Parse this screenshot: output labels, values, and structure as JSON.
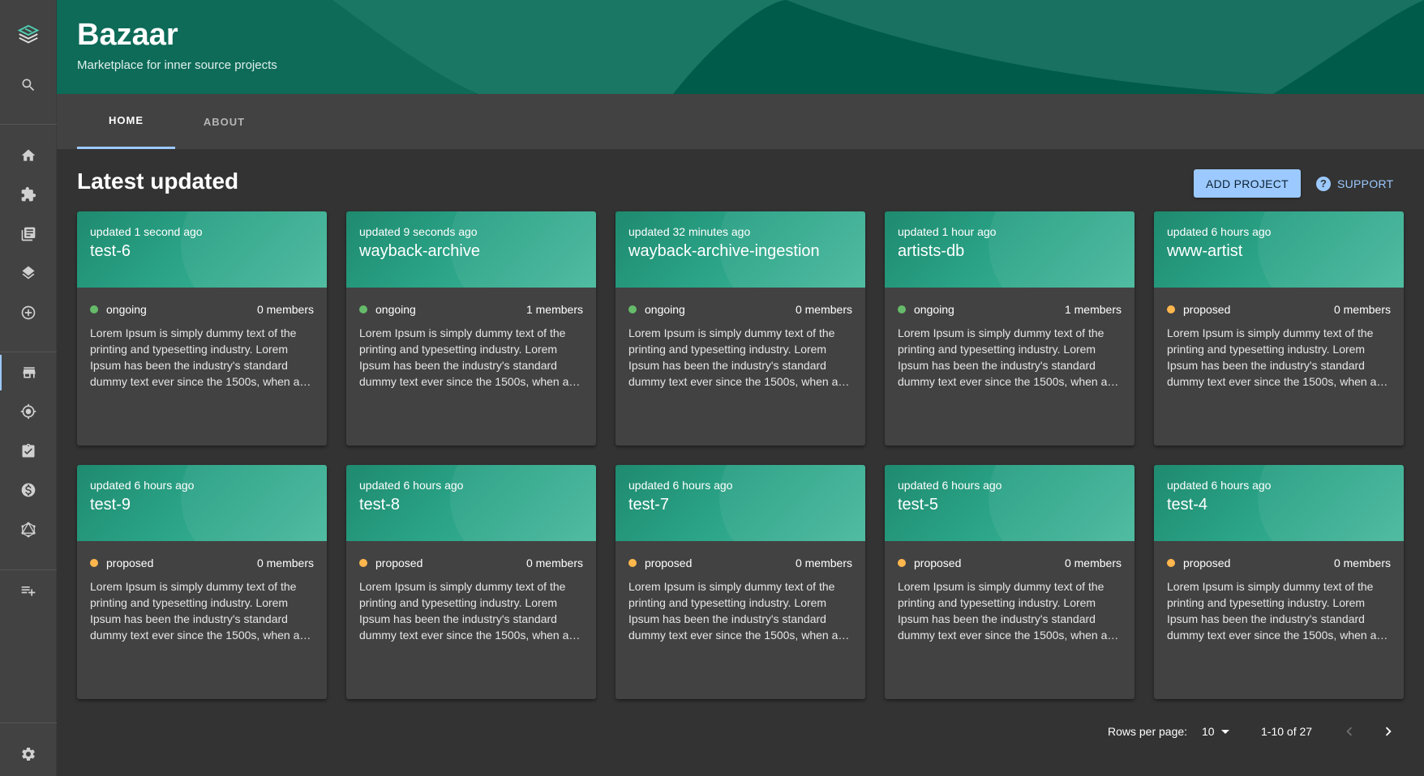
{
  "app": {
    "title": "Bazaar",
    "subtitle": "Marketplace for inner source projects"
  },
  "sidebar": {
    "items": [
      {
        "icon": "app-logo-icon"
      },
      {
        "icon": "search-icon"
      },
      {
        "icon": "home-icon"
      },
      {
        "icon": "extension-icon"
      },
      {
        "icon": "library-books-icon"
      },
      {
        "icon": "layers-icon"
      },
      {
        "icon": "add-circle-icon"
      },
      {
        "icon": "storefront-icon",
        "active": true
      },
      {
        "icon": "gps-target-icon"
      },
      {
        "icon": "assignment-check-icon"
      },
      {
        "icon": "money-icon"
      },
      {
        "icon": "graphql-icon"
      },
      {
        "icon": "playlist-add-icon"
      },
      {
        "icon": "gear-icon"
      }
    ]
  },
  "tabs": [
    {
      "label": "HOME",
      "active": true
    },
    {
      "label": "ABOUT",
      "active": false
    }
  ],
  "main": {
    "section_title": "Latest updated",
    "add_project_label": "ADD PROJECT",
    "support_label": "SUPPORT"
  },
  "status_colors": {
    "ongoing": "#66bb6a",
    "proposed": "#ffb74d"
  },
  "projects": [
    {
      "updated": "updated 1 second ago",
      "name": "test-6",
      "status": "ongoing",
      "members": "0 members",
      "description": "Lorem Ipsum is simply dummy text of the printing and typesetting industry. Lorem Ipsum has been the industry's standard dummy text ever since the 1500s, when an unknown printer took a galley of type and…"
    },
    {
      "updated": "updated 9 seconds ago",
      "name": "wayback-archive",
      "status": "ongoing",
      "members": "1 members",
      "description": "Lorem Ipsum is simply dummy text of the printing and typesetting industry. Lorem Ipsum has been the industry's standard dummy text ever since the 1500s, when an unknown printer took a galley of type and…"
    },
    {
      "updated": "updated 32 minutes ago",
      "name": "wayback-archive-ingestion",
      "status": "ongoing",
      "members": "0 members",
      "description": "Lorem Ipsum is simply dummy text of the printing and typesetting industry. Lorem Ipsum has been the industry's standard dummy text ever since the 1500s, when an unknown printer took a galley of type and…"
    },
    {
      "updated": "updated 1 hour ago",
      "name": "artists-db",
      "status": "ongoing",
      "members": "1 members",
      "description": "Lorem Ipsum is simply dummy text of the printing and typesetting industry. Lorem Ipsum has been the industry's standard dummy text ever since the 1500s, when an unknown printer took a galley of type and…"
    },
    {
      "updated": "updated 6 hours ago",
      "name": "www-artist",
      "status": "proposed",
      "members": "0 members",
      "description": "Lorem Ipsum is simply dummy text of the printing and typesetting industry. Lorem Ipsum has been the industry's standard dummy text ever since the 1500s, when an unknown printer took a galley of type and…"
    },
    {
      "updated": "updated 6 hours ago",
      "name": "test-9",
      "status": "proposed",
      "members": "0 members",
      "description": "Lorem Ipsum is simply dummy text of the printing and typesetting industry. Lorem Ipsum has been the industry's standard dummy text ever since the 1500s, when an unknown printer took a galley of type and…"
    },
    {
      "updated": "updated 6 hours ago",
      "name": "test-8",
      "status": "proposed",
      "members": "0 members",
      "description": "Lorem Ipsum is simply dummy text of the printing and typesetting industry. Lorem Ipsum has been the industry's standard dummy text ever since the 1500s, when an unknown printer took a galley of type and…"
    },
    {
      "updated": "updated 6 hours ago",
      "name": "test-7",
      "status": "proposed",
      "members": "0 members",
      "description": "Lorem Ipsum is simply dummy text of the printing and typesetting industry. Lorem Ipsum has been the industry's standard dummy text ever since the 1500s, when an unknown printer took a galley of type and…"
    },
    {
      "updated": "updated 6 hours ago",
      "name": "test-5",
      "status": "proposed",
      "members": "0 members",
      "description": "Lorem Ipsum is simply dummy text of the printing and typesetting industry. Lorem Ipsum has been the industry's standard dummy text ever since the 1500s, when an unknown printer took a galley of type and…"
    },
    {
      "updated": "updated 6 hours ago",
      "name": "test-4",
      "status": "proposed",
      "members": "0 members",
      "description": "Lorem Ipsum is simply dummy text of the printing and typesetting industry. Lorem Ipsum has been the industry's standard dummy text ever since the 1500s, when an unknown printer took a galley of type and…"
    }
  ],
  "pagination": {
    "rows_per_page_label": "Rows per page:",
    "rows_per_page_value": "10",
    "range_text": "1-10 of 27"
  }
}
